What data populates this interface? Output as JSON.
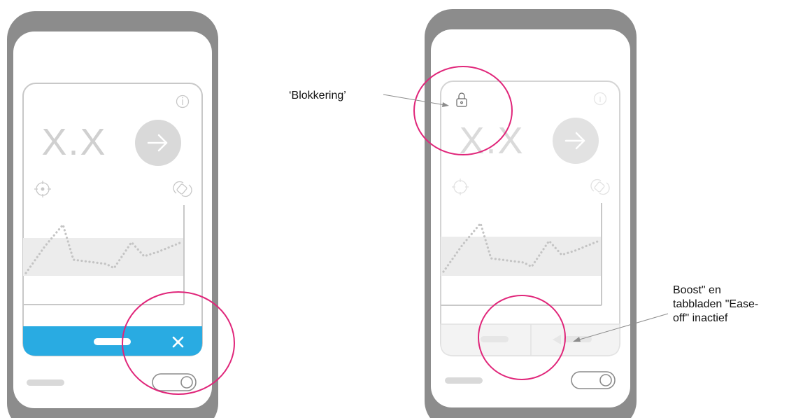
{
  "left_phone": {
    "value_display": "X.X",
    "state": "active",
    "bottom_bar_color": "#29abe2",
    "close_glyph": "×"
  },
  "right_phone": {
    "value_display": "X.X",
    "state": "locked"
  },
  "annotations": {
    "lock_label": "‘Blokkering’",
    "tabs_label": "Boost\" en\ntabbladen \"Ease-\noff\" inactief"
  },
  "colors": {
    "phone_frame": "#8c8c8c",
    "screen": "#ffffff",
    "card_outline": "#c8c8c8",
    "ui_light_gray": "#d9d9d9",
    "graph_band": "#ececec",
    "graph_dots": "#c4c4c4",
    "highlight_circle": "#e0267a",
    "leader_line": "#8c8c8c"
  },
  "icons": [
    "info-icon",
    "arrow-right-icon",
    "target-icon",
    "rotate-icon",
    "lock-icon",
    "close-icon",
    "toggle-switch"
  ]
}
